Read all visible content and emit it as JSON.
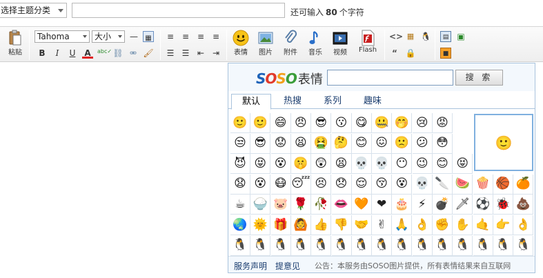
{
  "topbar": {
    "category_select": "选择主题分类",
    "remaining_prefix": "还可输入",
    "remaining_count": "80",
    "remaining_suffix": "个字符"
  },
  "toolbar": {
    "paste_label": "粘贴",
    "font_family": "Tahoma",
    "font_size": "大小",
    "tools": {
      "emoticon": "表情",
      "image": "图片",
      "attachment": "附件",
      "music": "音乐",
      "video": "视频",
      "flash": "Flash"
    }
  },
  "emoticon_panel": {
    "logo_text": "SOSO",
    "logo_suffix": "表情",
    "search_placeholder": "",
    "search_button": "搜 索",
    "tabs": [
      "默认",
      "热搜",
      "系列",
      "趣味"
    ],
    "active_tab": "默认",
    "footer": {
      "service_terms": "服务声明",
      "feedback": "提意见",
      "notice": "公告：本服务由SOSO图片提供，所有表情结果来自互联网"
    },
    "emoticons": [
      [
        "🙂",
        "🙂",
        "😄",
        "😠",
        "😎",
        "😗",
        "😋",
        "🤐",
        "🤭",
        "😢",
        "😡"
      ],
      [
        "😒",
        "😎",
        "😟",
        "😫",
        "🤮",
        "🤔",
        "😊",
        "😖",
        "🙁",
        "😕",
        "😳"
      ],
      [
        "😈",
        "😝",
        "😵",
        "🤫",
        "😲",
        "😫",
        "💀",
        "💀",
        "😶",
        "😉",
        "😊",
        "😝"
      ],
      [
        "😧",
        "😵",
        "😷",
        "😴",
        "😣",
        "😞",
        "😌",
        "😚",
        "😵",
        "💀",
        "🔪",
        "🍉",
        "🍿",
        "🏀",
        "🍊"
      ],
      [
        "☕",
        "🍚",
        "🐷",
        "🌹",
        "🥀",
        "👄",
        "🧡",
        "❤",
        "🎂",
        "⚡",
        "💣",
        "🗡",
        "⚽",
        "🐞",
        "💩"
      ],
      [
        "🌏",
        "🌞",
        "🎁",
        "🙆",
        "👍",
        "👎",
        "🤝",
        "✌",
        "🙏",
        "👌",
        "✊",
        "✋",
        "🤙",
        "👉",
        "👌"
      ],
      [
        "🐧",
        "🐧",
        "🐧",
        "🐧",
        "🐧",
        "🐧",
        "🐧",
        "🐧",
        "🐧",
        "🐧",
        "🐧",
        "🐧",
        "🐧",
        "🐧",
        "🐧"
      ]
    ],
    "preview_emoticon": "🙂"
  },
  "colors": {
    "panel_border": "#a9c3dd",
    "panel_head_bg": "#f3f8fd",
    "link": "#1a3c6e"
  }
}
